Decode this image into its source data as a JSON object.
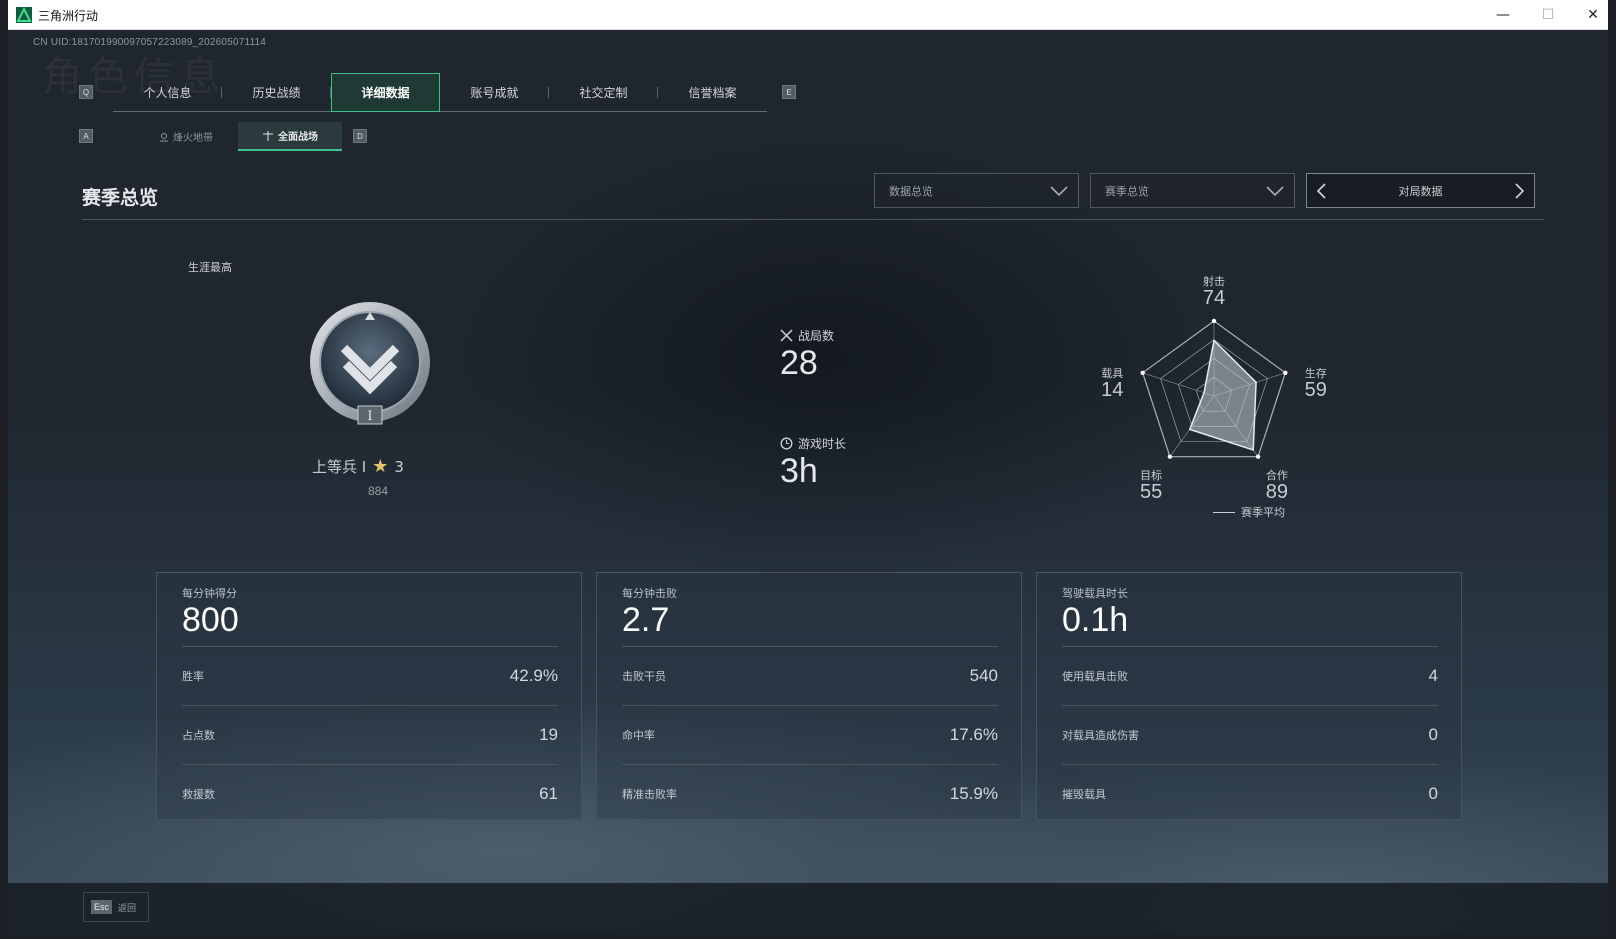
{
  "window": {
    "title": "三角洲行动"
  },
  "uid": "CN UID:1817019900970572230​89_202605071114",
  "bg_deco": "角色信息",
  "keys": {
    "tab_prev": "Q",
    "tab_next": "E",
    "sub_prev": "A",
    "sub_next": "D"
  },
  "tabs": [
    {
      "label": "个人信息"
    },
    {
      "label": "历史战绩"
    },
    {
      "label": "详细数据"
    },
    {
      "label": "账号成就"
    },
    {
      "label": "社交定制"
    },
    {
      "label": "信誉档案"
    }
  ],
  "subtabs": [
    {
      "label": "烽火地带"
    },
    {
      "label": "全面战场"
    }
  ],
  "section_title": "赛季总览",
  "dropdowns": {
    "data_scope": "数据总览",
    "season": "赛季总览"
  },
  "pager": {
    "label": "对局数据"
  },
  "career": {
    "label": "生涯最高",
    "rank_name": "上等兵 I",
    "stars": "3",
    "points": "884",
    "badge_roman": "I"
  },
  "mid_stats": {
    "matches": {
      "label": "战局数",
      "value": "28"
    },
    "playtime": {
      "label": "游戏时长",
      "value": "3h"
    }
  },
  "radar": {
    "axes": [
      {
        "label": "射击",
        "value": 74
      },
      {
        "label": "生存",
        "value": 59
      },
      {
        "label": "合作",
        "value": 89
      },
      {
        "label": "目标",
        "value": 55
      },
      {
        "label": "载具",
        "value": 14
      }
    ],
    "legend": "赛季平均"
  },
  "cards": [
    {
      "head_label": "每分钟得分",
      "head_value": "800",
      "rows": [
        {
          "k": "胜率",
          "v": "42.9%"
        },
        {
          "k": "占点数",
          "v": "19"
        },
        {
          "k": "救援数",
          "v": "61"
        }
      ]
    },
    {
      "head_label": "每分钟击败",
      "head_value": "2.7",
      "rows": [
        {
          "k": "击败干员",
          "v": "540"
        },
        {
          "k": "命中率",
          "v": "17.6%"
        },
        {
          "k": "精准击败率",
          "v": "15.9%"
        }
      ]
    },
    {
      "head_label": "驾驶载具时长",
      "head_value": "0.1h",
      "rows": [
        {
          "k": "使用载具击败",
          "v": "4"
        },
        {
          "k": "对载具造成伤害",
          "v": "0"
        },
        {
          "k": "摧毁载具",
          "v": "0"
        }
      ]
    }
  ],
  "footer": {
    "esc_key": "Esc",
    "esc_label": "返回"
  },
  "colors": {
    "accent": "#3fbf8a",
    "text": "#e4e8eb"
  }
}
